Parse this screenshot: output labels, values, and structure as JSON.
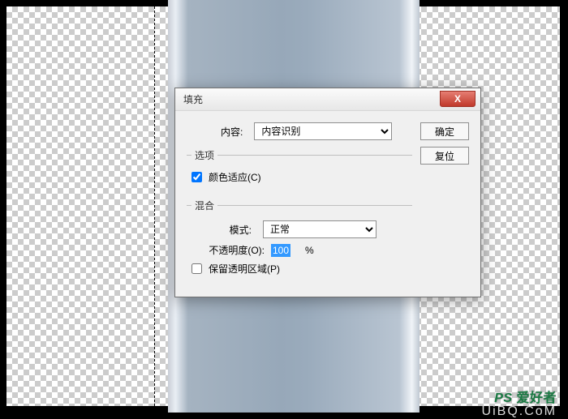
{
  "dialog": {
    "title": "填充",
    "close_symbol": "X",
    "content_label": "内容:",
    "content_value": "内容识别",
    "options_legend": "选项",
    "color_adapt_label": "颜色适应(C)",
    "color_adapt_checked": true,
    "blend_legend": "混合",
    "mode_label": "模式:",
    "mode_value": "正常",
    "opacity_label": "不透明度(O):",
    "opacity_value": "100",
    "opacity_unit": "%",
    "preserve_label": "保留透明区域(P)",
    "preserve_checked": false,
    "ok_label": "确定",
    "reset_label": "复位"
  },
  "watermark": {
    "line1_a": "PS",
    "line1_b": "爱好者",
    "line2": "UiBQ.CoM"
  }
}
